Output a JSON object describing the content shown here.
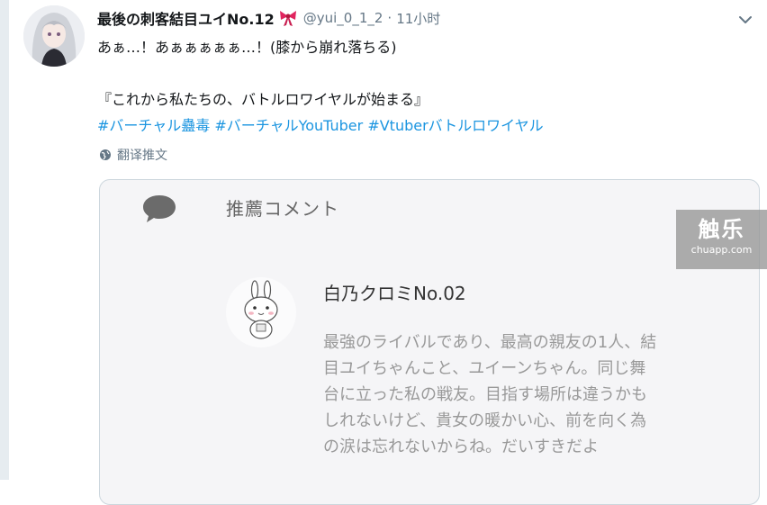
{
  "tweet": {
    "display_name": "最後の刺客結目ユイNo.12",
    "handle": "@yui_0_1_2",
    "separator": "·",
    "time": "11小时",
    "text_lines": [
      "あぁ…！あぁぁぁぁぁ…！(膝から崩れ落ちる)",
      "",
      "『これから私たちの、バトルロワイヤルが始まる』"
    ],
    "hashtags": [
      "#バーチャル蠱毒",
      "#バーチャルYouTuber",
      "#Vtuberバトルロワイヤル"
    ],
    "translate_label": "翻译推文"
  },
  "card": {
    "heading": "推薦コメント",
    "recommender_name": "白乃クロミNo.02",
    "comment_lines": [
      "最強のライバルであり、最高の親友の1人、結",
      "目ユイちゃんこと、ユイーンちゃん。同じ舞",
      "台に立った私の戦友。目指す場所は違うかも",
      "しれないけど、貴女の暖かい心、前を向く為",
      "の涙は忘れないからね。だいすきだよ"
    ]
  },
  "watermark": {
    "logo": "触乐",
    "url": "chuapp.com"
  },
  "icons": {
    "ribbon": "ribbon-emoji",
    "caret": "chevron-down-icon",
    "globe": "globe-icon",
    "comment": "speech-bubble-icon"
  },
  "colors": {
    "hashtag": "#1b95e0",
    "muted": "#657786",
    "card_bg": "#f5f5f7"
  }
}
